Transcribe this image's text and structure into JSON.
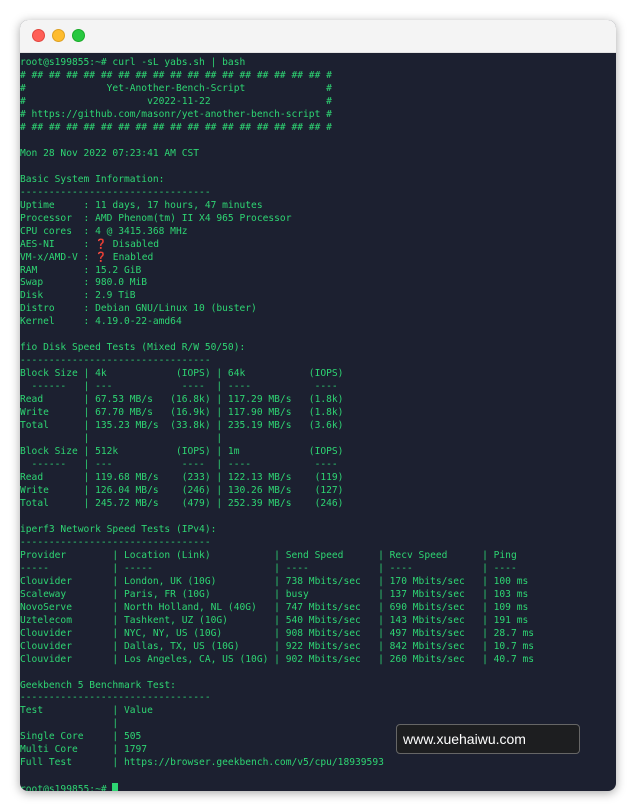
{
  "window": {
    "buttons": [
      "close",
      "minimize",
      "maximize"
    ]
  },
  "terminal": {
    "lines": [
      "root@s199855:~# curl -sL yabs.sh | bash",
      "# ## ## ## ## ## ## ## ## ## ## ## ## ## ## ## ## ## #",
      "#              Yet-Another-Bench-Script              #",
      "#                     v2022-11-22                    #",
      "# https://github.com/masonr/yet-another-bench-script #",
      "# ## ## ## ## ## ## ## ## ## ## ## ## ## ## ## ## ## #",
      "",
      "Mon 28 Nov 2022 07:23:41 AM CST",
      "",
      "Basic System Information:",
      "---------------------------------",
      "Uptime     : 11 days, 17 hours, 47 minutes",
      "Processor  : AMD Phenom(tm) II X4 965 Processor",
      "CPU cores  : 4 @ 3415.368 MHz",
      "AES-NI     : ❓ Disabled",
      "VM-x/AMD-V : ❓ Enabled",
      "RAM        : 15.2 GiB",
      "Swap       : 980.0 MiB",
      "Disk       : 2.9 TiB",
      "Distro     : Debian GNU/Linux 10 (buster)",
      "Kernel     : 4.19.0-22-amd64",
      "",
      "fio Disk Speed Tests (Mixed R/W 50/50):",
      "---------------------------------",
      "Block Size | 4k            (IOPS) | 64k           (IOPS)",
      "  ------   | ---            ----  | ----           ----",
      "Read       | 67.53 MB/s   (16.8k) | 117.29 MB/s   (1.8k)",
      "Write      | 67.70 MB/s   (16.9k) | 117.90 MB/s   (1.8k)",
      "Total      | 135.23 MB/s  (33.8k) | 235.19 MB/s   (3.6k)",
      "           |                      |",
      "Block Size | 512k          (IOPS) | 1m            (IOPS)",
      "  ------   | ---            ----  | ----           ----",
      "Read       | 119.68 MB/s    (233) | 122.13 MB/s    (119)",
      "Write      | 126.04 MB/s    (246) | 130.26 MB/s    (127)",
      "Total      | 245.72 MB/s    (479) | 252.39 MB/s    (246)",
      "",
      "iperf3 Network Speed Tests (IPv4):",
      "---------------------------------",
      "Provider        | Location (Link)           | Send Speed      | Recv Speed      | Ping",
      "-----           | -----                     | ----            | ----            | ----",
      "Clouvider       | London, UK (10G)          | 738 Mbits/sec   | 170 Mbits/sec   | 100 ms",
      "Scaleway        | Paris, FR (10G)           | busy            | 137 Mbits/sec   | 103 ms",
      "NovoServe       | North Holland, NL (40G)   | 747 Mbits/sec   | 690 Mbits/sec   | 109 ms",
      "Uztelecom       | Tashkent, UZ (10G)        | 540 Mbits/sec   | 143 Mbits/sec   | 191 ms",
      "Clouvider       | NYC, NY, US (10G)         | 908 Mbits/sec   | 497 Mbits/sec   | 28.7 ms",
      "Clouvider       | Dallas, TX, US (10G)      | 922 Mbits/sec   | 842 Mbits/sec   | 10.7 ms",
      "Clouvider       | Los Angeles, CA, US (10G) | 902 Mbits/sec   | 260 Mbits/sec   | 40.7 ms",
      "",
      "Geekbench 5 Benchmark Test:",
      "---------------------------------",
      "Test            | Value",
      "                |",
      "Single Core     | 505",
      "Multi Core      | 1797",
      "Full Test       | https://browser.geekbench.com/v5/cpu/18939593",
      "",
      "root@s199855:~# "
    ]
  },
  "watermark": {
    "text": "www.xuehaiwu.com"
  },
  "colors": {
    "terminal_bg": "#1c2030",
    "terminal_text": "#2ed573",
    "titlebar_bg": "#f4f4f4"
  }
}
